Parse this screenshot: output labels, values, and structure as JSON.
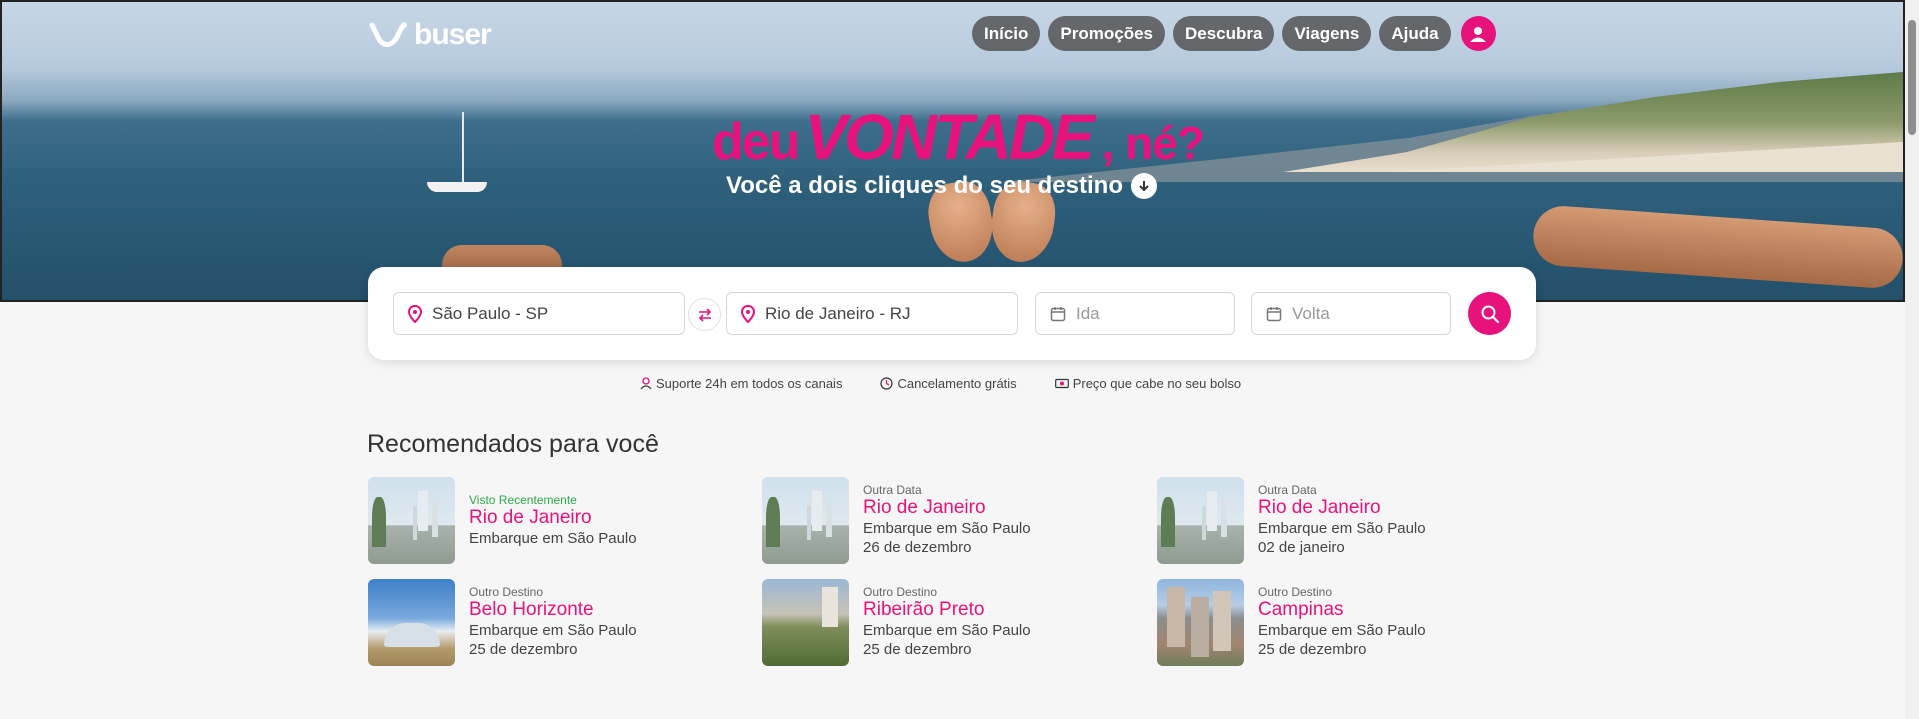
{
  "brand": {
    "name": "buser"
  },
  "nav": {
    "items": [
      "Início",
      "Promoções",
      "Descubra",
      "Viagens",
      "Ajuda"
    ]
  },
  "hero": {
    "headline_a": "deu",
    "headline_b": "VONTADE",
    "headline_c": ", né?",
    "subline": "Você a dois cliques do seu destino"
  },
  "search": {
    "origin": "São Paulo - SP",
    "destination": "Rio de Janeiro - RJ",
    "ida_placeholder": "Ida",
    "volta_placeholder": "Volta"
  },
  "benefits": [
    "Suporte 24h em todos os canais",
    "Cancelamento grátis",
    "Preço que cabe no seu bolso"
  ],
  "recommendations": {
    "title": "Recomendados para você",
    "cards": [
      {
        "tag": "Visto Recentemente",
        "city": "Rio de Janeiro",
        "line1": "Embarque em São Paulo",
        "line2": ""
      },
      {
        "tag": "Outra Data",
        "city": "Rio de Janeiro",
        "line1": "Embarque em São Paulo",
        "line2": "26 de dezembro"
      },
      {
        "tag": "Outra Data",
        "city": "Rio de Janeiro",
        "line1": "Embarque em São Paulo",
        "line2": "02 de janeiro"
      },
      {
        "tag": "Outro Destino",
        "city": "Belo Horizonte",
        "line1": "Embarque em São Paulo",
        "line2": "25 de dezembro"
      },
      {
        "tag": "Outro Destino",
        "city": "Ribeirão Preto",
        "line1": "Embarque em São Paulo",
        "line2": "25 de dezembro"
      },
      {
        "tag": "Outro Destino",
        "city": "Campinas",
        "line1": "Embarque em São Paulo",
        "line2": "25 de dezembro"
      }
    ]
  },
  "colors": {
    "accent": "#e8127c",
    "recent_tag": "#2da84a"
  },
  "icons": [
    "logo-icon",
    "user-icon",
    "arrow-down-icon",
    "pin-icon",
    "swap-icon",
    "calendar-icon",
    "search-icon",
    "support-icon",
    "clock-icon",
    "money-icon"
  ]
}
